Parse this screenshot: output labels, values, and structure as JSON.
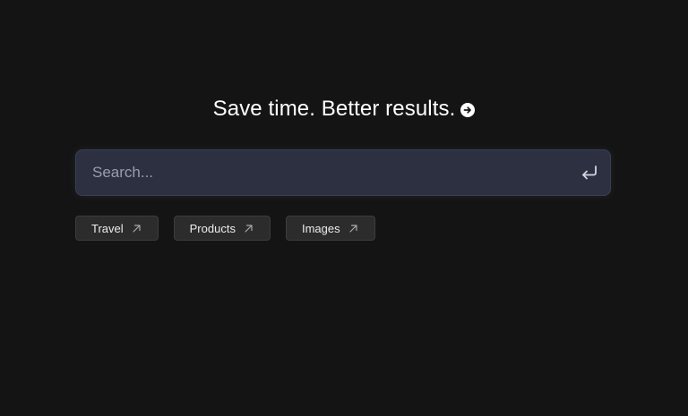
{
  "headline": {
    "text": "Save time. Better results."
  },
  "search": {
    "placeholder": "Search...",
    "value": ""
  },
  "chips": [
    {
      "label": "Travel"
    },
    {
      "label": "Products"
    },
    {
      "label": "Images"
    }
  ],
  "icons": {
    "headline_arrow": "arrow-right-circle-icon",
    "enter": "enter-return-icon",
    "chip_arrow": "arrow-up-right-icon"
  },
  "colors": {
    "background": "#141414",
    "search_box": "#2d3041",
    "chip": "#2c2c2c",
    "text": "#ffffff"
  }
}
